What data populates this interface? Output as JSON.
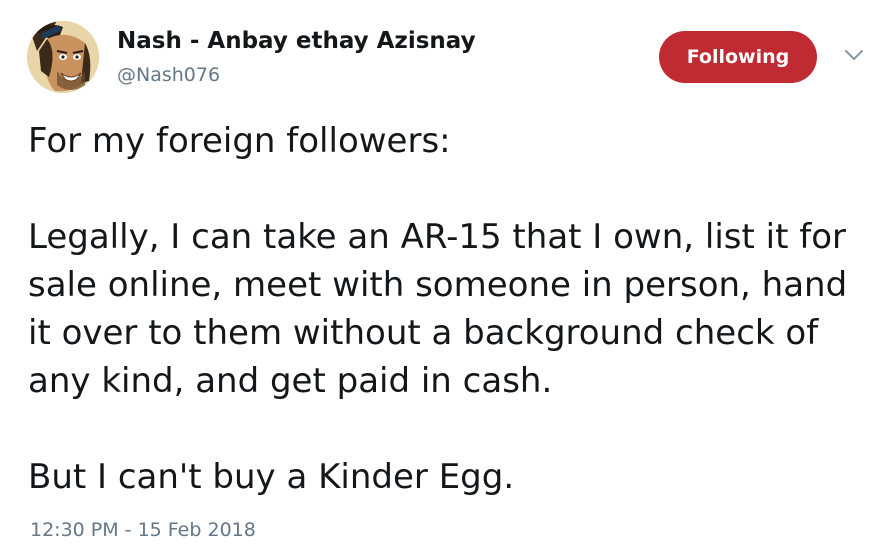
{
  "author": {
    "display_name": "Nash - Anbay ethay Azisnay",
    "handle": "@Nash076",
    "avatar_icon": "cartoon-avatar-icon"
  },
  "follow_button": {
    "label": "Following",
    "color": "#bf2a33"
  },
  "menu_caret_icon": "chevron-down-icon",
  "tweet": {
    "paragraph1": "For my foreign followers:",
    "paragraph2": "Legally, I can take an AR-15 that I own, list it for sale online, meet with someone in person, hand it over to them without a background check of any kind, and get paid in cash.",
    "paragraph3": "But I can't buy a Kinder Egg."
  },
  "timestamp": "12:30 PM - 15 Feb 2018"
}
